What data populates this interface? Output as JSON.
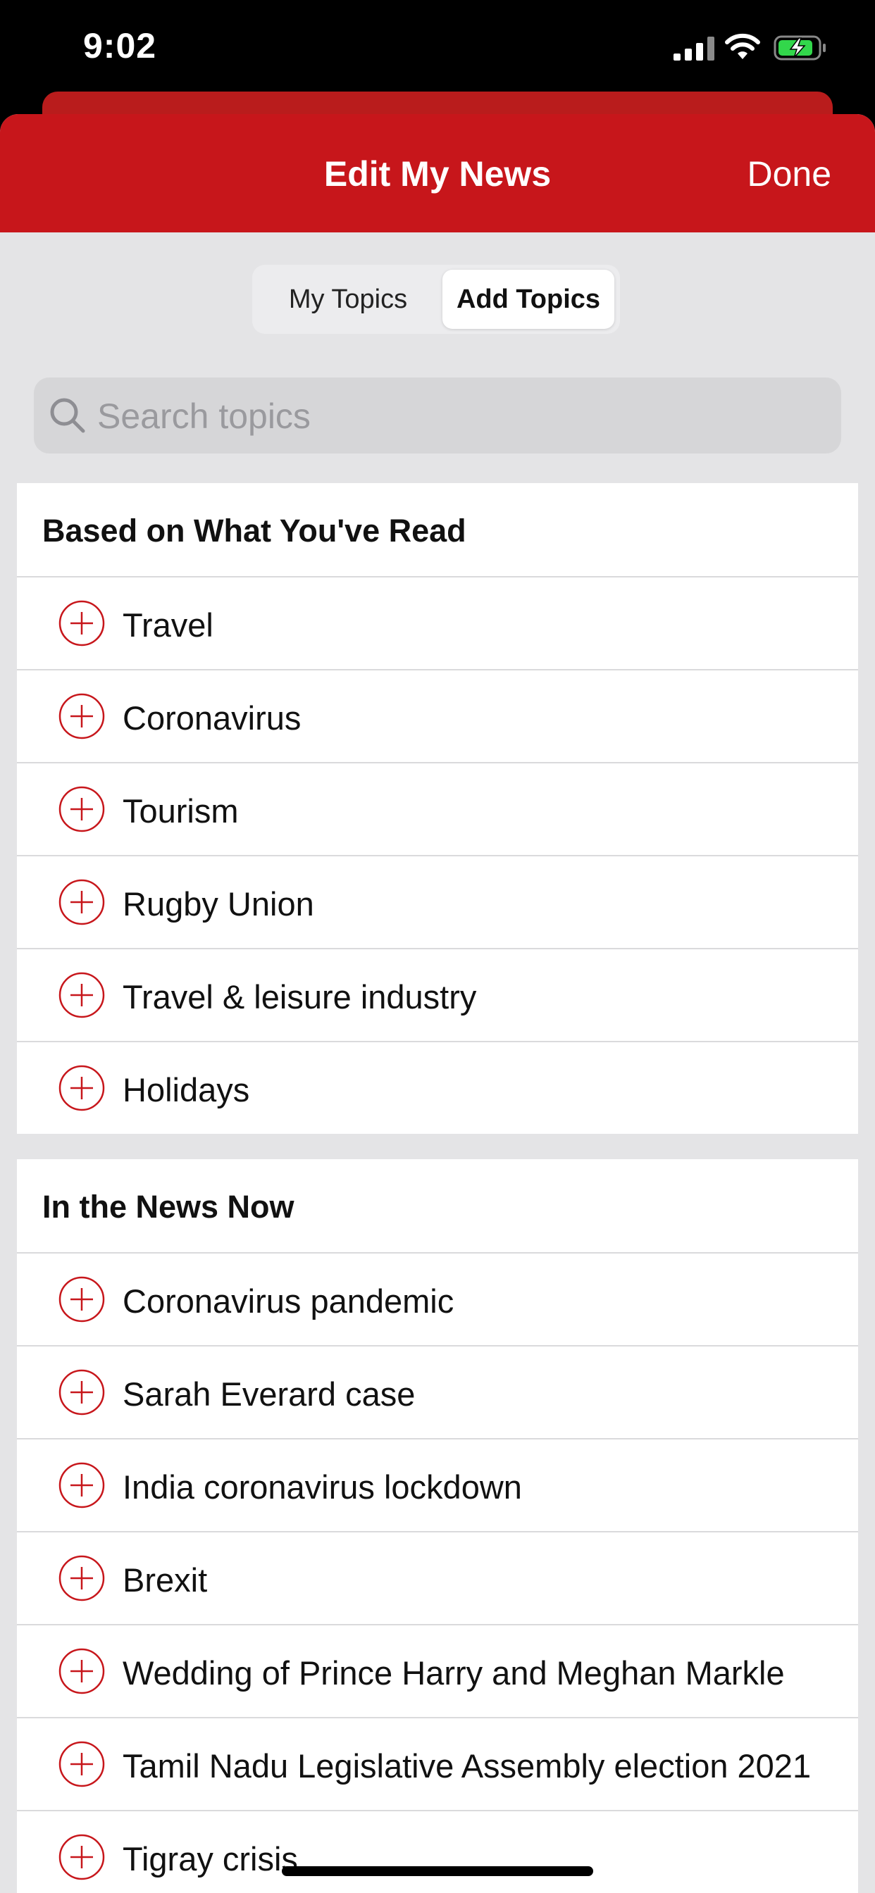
{
  "status_bar": {
    "time": "9:02"
  },
  "nav": {
    "title": "Edit My News",
    "done_label": "Done"
  },
  "segments": {
    "my_topics": "My Topics",
    "add_topics": "Add Topics",
    "selected": "Add Topics"
  },
  "search": {
    "placeholder": "Search topics",
    "value": ""
  },
  "sections": [
    {
      "title": "Based on What You've Read",
      "items": [
        {
          "label": "Travel"
        },
        {
          "label": "Coronavirus"
        },
        {
          "label": "Tourism"
        },
        {
          "label": "Rugby Union"
        },
        {
          "label": "Travel & leisure industry"
        },
        {
          "label": "Holidays"
        }
      ]
    },
    {
      "title": "In the News Now",
      "items": [
        {
          "label": "Coronavirus pandemic"
        },
        {
          "label": "Sarah Everard case"
        },
        {
          "label": "India coronavirus lockdown"
        },
        {
          "label": "Brexit"
        },
        {
          "label": "Wedding of Prince Harry and Meghan Markle"
        },
        {
          "label": "Tamil Nadu Legislative Assembly election 2021"
        },
        {
          "label": "Tigray crisis"
        }
      ]
    }
  ],
  "colors": {
    "accent": "#c7161b",
    "background": "#e4e4e6",
    "battery_charge": "#32d74b"
  },
  "icons": {
    "add": "plus-circle-icon",
    "search": "search-icon"
  }
}
